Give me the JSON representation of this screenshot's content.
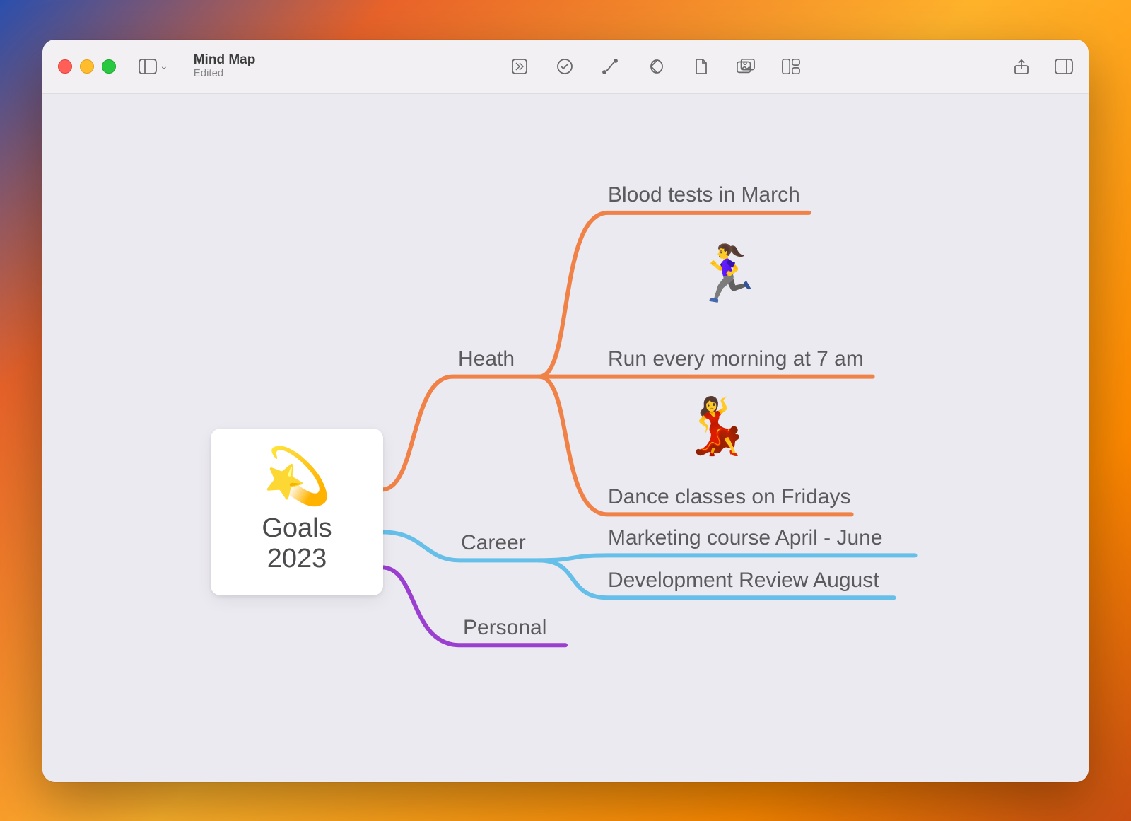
{
  "window": {
    "title": "Mind Map",
    "subtitle": "Edited"
  },
  "mindmap": {
    "root": {
      "icon": "💫",
      "label": "Goals 2023"
    },
    "branches": [
      {
        "label": "Heath",
        "color": "#f08248",
        "children": [
          {
            "label": "Blood tests in March",
            "icon": null
          },
          {
            "label": "Run every morning at 7 am",
            "icon": "🏃‍♀️"
          },
          {
            "label": "Dance classes on Fridays",
            "icon": "💃"
          }
        ]
      },
      {
        "label": "Career",
        "color": "#66bfe9",
        "children": [
          {
            "label": "Marketing course April - June",
            "icon": null
          },
          {
            "label": "Development Review August",
            "icon": null
          }
        ]
      },
      {
        "label": "Personal",
        "color": "#9a3fd0",
        "children": []
      }
    ]
  }
}
